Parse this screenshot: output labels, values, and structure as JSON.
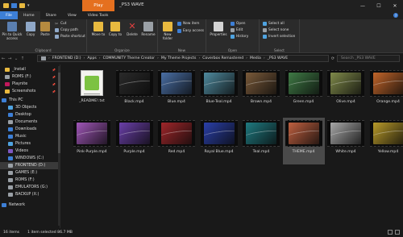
{
  "window": {
    "contextual_tab": "Play",
    "title": "_PS3 WAVE",
    "minimize": "—",
    "maximize": "☐",
    "close": "✕"
  },
  "ribbon_tabs": [
    "File",
    "Home",
    "Share",
    "View",
    "Video Tools"
  ],
  "ribbon": {
    "clipboard": {
      "label": "Clipboard",
      "pin": "Pin to Quick access",
      "copy": "Copy",
      "paste": "Paste",
      "cut": "Cut",
      "copy_path": "Copy path",
      "paste_shortcut": "Paste shortcut"
    },
    "organize": {
      "label": "Organize",
      "move_to": "Move to",
      "copy_to": "Copy to",
      "delete": "Delete",
      "rename": "Rename"
    },
    "new": {
      "label": "New",
      "new_folder": "New folder",
      "new_item": "New item",
      "easy_access": "Easy access"
    },
    "open": {
      "label": "Open",
      "properties": "Properties",
      "open": "Open",
      "edit": "Edit",
      "history": "History"
    },
    "select": {
      "label": "Select",
      "select_all": "Select all",
      "select_none": "Select none",
      "invert": "Invert selection"
    }
  },
  "address": {
    "crumbs": [
      "FRONTEND (D:)",
      "Apps",
      "COMMUNITY Theme Creator",
      "My Theme Projects",
      "Coverbox Remastered",
      "Media",
      "_PS3 WAVE"
    ],
    "search_placeholder": "Search _PS3 WAVE"
  },
  "sidebar": [
    {
      "label": "_Install",
      "color": "#e8b93f",
      "pinned": true
    },
    {
      "label": "ROMS (F:)",
      "color": "#9aa0a6",
      "pinned": true
    },
    {
      "label": "Playnite",
      "color": "#c2185b",
      "pinned": true
    },
    {
      "label": "Screenshots",
      "color": "#e8b93f",
      "pinned": true
    },
    {
      "label": "This PC",
      "color": "#3d7fd6",
      "pinned": false
    },
    {
      "label": "3D Objects",
      "color": "#4fa3e0",
      "pinned": false
    },
    {
      "label": "Desktop",
      "color": "#3d7fd6",
      "pinned": false
    },
    {
      "label": "Documents",
      "color": "#9aa0a6",
      "pinned": false
    },
    {
      "label": "Downloads",
      "color": "#3d7fd6",
      "pinned": false
    },
    {
      "label": "Music",
      "color": "#3d7fd6",
      "pinned": false
    },
    {
      "label": "Pictures",
      "color": "#4fa3e0",
      "pinned": false
    },
    {
      "label": "Videos",
      "color": "#7e57c2",
      "pinned": false
    },
    {
      "label": "WINDOWS (C:)",
      "color": "#3d7fd6",
      "pinned": false
    },
    {
      "label": "FRONTEND (D:)",
      "color": "#9aa0a6",
      "pinned": false,
      "selected": true
    },
    {
      "label": "GAMES (E:)",
      "color": "#9aa0a6",
      "pinned": false
    },
    {
      "label": "ROMS (F:)",
      "color": "#9aa0a6",
      "pinned": false
    },
    {
      "label": "EMULATORS (G:)",
      "color": "#9aa0a6",
      "pinned": false
    },
    {
      "label": "BACKUP (X:)",
      "color": "#9aa0a6",
      "pinned": false
    },
    {
      "label": "Network",
      "color": "#3d7fd6",
      "pinned": false
    }
  ],
  "files": [
    {
      "name": "_README!.txt",
      "type": "txt"
    },
    {
      "name": "Black.mp4",
      "color": "#2a2a2a"
    },
    {
      "name": "Blue.mp4",
      "color": "#4a6fa5"
    },
    {
      "name": "Blue-Teal.mp4",
      "color": "#4f8a9e"
    },
    {
      "name": "Brown.mp4",
      "color": "#7a5a3a"
    },
    {
      "name": "Green.mp4",
      "color": "#3f7a45"
    },
    {
      "name": "Olive.mp4",
      "color": "#7f8a4a"
    },
    {
      "name": "Orange.mp4",
      "color": "#c2652a"
    },
    {
      "name": "Pink-Purple.mp4",
      "color": "#a056b8"
    },
    {
      "name": "Purple.mp4",
      "color": "#6a3fa8"
    },
    {
      "name": "Red.mp4",
      "color": "#a0262a"
    },
    {
      "name": "Royal Blue.mp4",
      "color": "#2a3fa8"
    },
    {
      "name": "Teal.mp4",
      "color": "#1f7a80"
    },
    {
      "name": "THEME.mp4",
      "color": "#c06040",
      "selected": true
    },
    {
      "name": "White.mp4",
      "color": "#a8a8a8"
    },
    {
      "name": "Yellow.mp4",
      "color": "#b89a2a"
    }
  ],
  "status": {
    "count": "16 items",
    "selection": "1 item selected  86.7 MB"
  }
}
